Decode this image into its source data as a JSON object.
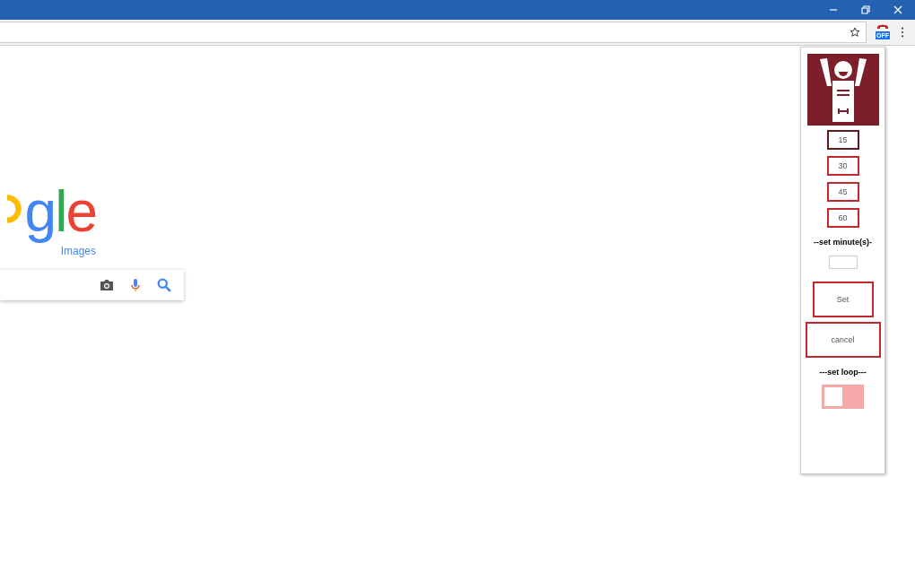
{
  "extension_badge": "OFF",
  "logo": {
    "letters": [
      {
        "text": "g",
        "color": "#4285f4"
      },
      {
        "text": "l",
        "color": "#34a853"
      },
      {
        "text": "e",
        "color": "#ea4335"
      }
    ],
    "subtitle": "Images"
  },
  "popup": {
    "presets": [
      {
        "label": "15",
        "selected": true
      },
      {
        "label": "30",
        "selected": false
      },
      {
        "label": "45",
        "selected": false
      },
      {
        "label": "60",
        "selected": false
      }
    ],
    "minutes_heading": "--set minute(s)-",
    "set_button": "Set",
    "cancel_button": "cancel",
    "loop_heading": "---set loop---",
    "loop": {
      "on": false
    }
  }
}
